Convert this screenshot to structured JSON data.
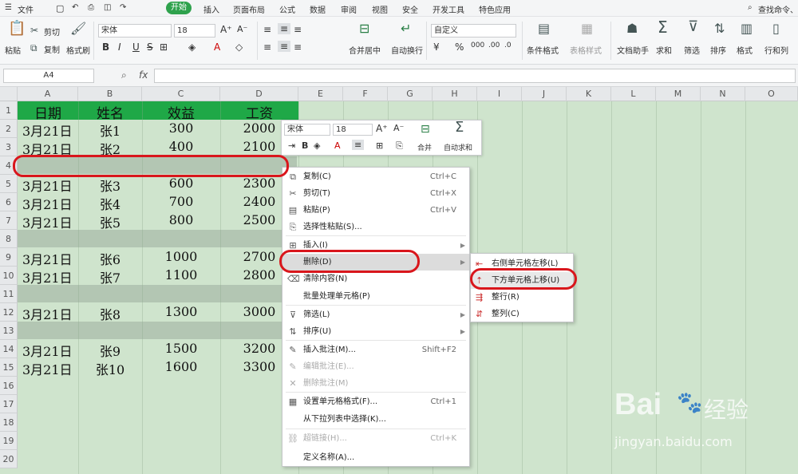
{
  "menubar": {
    "file": "文件",
    "tabs": [
      "开始",
      "插入",
      "页面布局",
      "公式",
      "数据",
      "审阅",
      "视图",
      "安全",
      "开发工具",
      "特色应用"
    ],
    "search": "查找命令、"
  },
  "ribbon": {
    "paste": "粘贴",
    "cut": "剪切",
    "copy": "复制",
    "format_painter": "格式刷",
    "font_name": "宋体",
    "font_size": "18",
    "merge": "合并居中",
    "wrap": "自动换行",
    "number_format": "自定义",
    "cond_format": "条件格式",
    "table_style": "表格样式",
    "doc_helper": "文档助手",
    "sum": "求和",
    "filter": "筛选",
    "sort": "排序",
    "format": "格式",
    "rowcol": "行和列"
  },
  "formula": {
    "name_box": "A4",
    "fx": "fx"
  },
  "columns": [
    "A",
    "B",
    "C",
    "D",
    "E",
    "F",
    "G",
    "H",
    "I",
    "J",
    "K",
    "L",
    "M",
    "N",
    "O"
  ],
  "rows": [
    "1",
    "2",
    "3",
    "4",
    "5",
    "6",
    "7",
    "8",
    "9",
    "10",
    "11",
    "12",
    "13",
    "14",
    "15",
    "16",
    "17",
    "18",
    "19",
    "20"
  ],
  "header": {
    "a": "日期",
    "b": "姓名",
    "c": "效益",
    "d": "工资"
  },
  "data": [
    {
      "r": 2,
      "a": "3月21日",
      "b": "张1",
      "c": "300",
      "d": "2000"
    },
    {
      "r": 3,
      "a": "3月21日",
      "b": "张2",
      "c": "400",
      "d": "2100"
    },
    {
      "r": 5,
      "a": "3月21日",
      "b": "张3",
      "c": "600",
      "d": "2300"
    },
    {
      "r": 6,
      "a": "3月21日",
      "b": "张4",
      "c": "700",
      "d": "2400"
    },
    {
      "r": 7,
      "a": "3月21日",
      "b": "张5",
      "c": "800",
      "d": "2500"
    },
    {
      "r": 9,
      "a": "3月21日",
      "b": "张6",
      "c": "1000",
      "d": "2700"
    },
    {
      "r": 10,
      "a": "3月21日",
      "b": "张7",
      "c": "1100",
      "d": "2800"
    },
    {
      "r": 12,
      "a": "3月21日",
      "b": "张8",
      "c": "1300",
      "d": "3000"
    },
    {
      "r": 14,
      "a": "3月21日",
      "b": "张9",
      "c": "1500",
      "d": "3200"
    },
    {
      "r": 15,
      "a": "3月21日",
      "b": "张10",
      "c": "1600",
      "d": "3300"
    }
  ],
  "mini_toolbar": {
    "font": "宋体",
    "size": "18",
    "merge": "合并",
    "autosum": "自动求和"
  },
  "context_menu": [
    {
      "label": "复制(C)",
      "shortcut": "Ctrl+C",
      "icon": "copy-icon"
    },
    {
      "label": "剪切(T)",
      "shortcut": "Ctrl+X",
      "icon": "scissors-icon"
    },
    {
      "label": "粘贴(P)",
      "shortcut": "Ctrl+V",
      "icon": "paste-icon"
    },
    {
      "label": "选择性粘贴(S)...",
      "shortcut": "",
      "icon": "paste-special-icon"
    },
    {
      "label": "插入(I)",
      "shortcut": "",
      "icon": "insert-icon"
    },
    {
      "label": "删除(D)",
      "shortcut": "",
      "icon": ""
    },
    {
      "label": "清除内容(N)",
      "shortcut": "",
      "icon": "clear-icon"
    },
    {
      "label": "批量处理单元格(P)",
      "shortcut": "",
      "icon": ""
    },
    {
      "label": "筛选(L)",
      "shortcut": "",
      "icon": "filter-icon"
    },
    {
      "label": "排序(U)",
      "shortcut": "",
      "icon": "sort-icon"
    },
    {
      "label": "插入批注(M)...",
      "shortcut": "Shift+F2",
      "icon": "comment-icon"
    },
    {
      "label": "编辑批注(E)...",
      "shortcut": "",
      "icon": "edit-comment-icon"
    },
    {
      "label": "删除批注(M)",
      "shortcut": "",
      "icon": "delete-comment-icon"
    },
    {
      "label": "设置单元格格式(F)...",
      "shortcut": "Ctrl+1",
      "icon": "format-cells-icon"
    },
    {
      "label": "从下拉列表中选择(K)...",
      "shortcut": "",
      "icon": ""
    },
    {
      "label": "超链接(H)...",
      "shortcut": "Ctrl+K",
      "icon": "link-icon"
    },
    {
      "label": "定义名称(A)...",
      "shortcut": "",
      "icon": ""
    }
  ],
  "submenu": [
    {
      "label": "右侧单元格左移(L)",
      "icon": "shift-left-icon"
    },
    {
      "label": "下方单元格上移(U)",
      "icon": "shift-up-icon"
    },
    {
      "label": "整行(R)",
      "icon": "delete-row-icon"
    },
    {
      "label": "整列(C)",
      "icon": "delete-column-icon"
    }
  ],
  "watermark": {
    "logo": "Bai",
    "logo2": "经验",
    "url": "jingyan.baidu.com"
  },
  "colors": {
    "green": "#2fa24d",
    "header_fill": "#1fa847",
    "grid_bg": "#cfe4cd",
    "blank_row": "#b3c6b3",
    "annotation_red": "#d9161c"
  }
}
